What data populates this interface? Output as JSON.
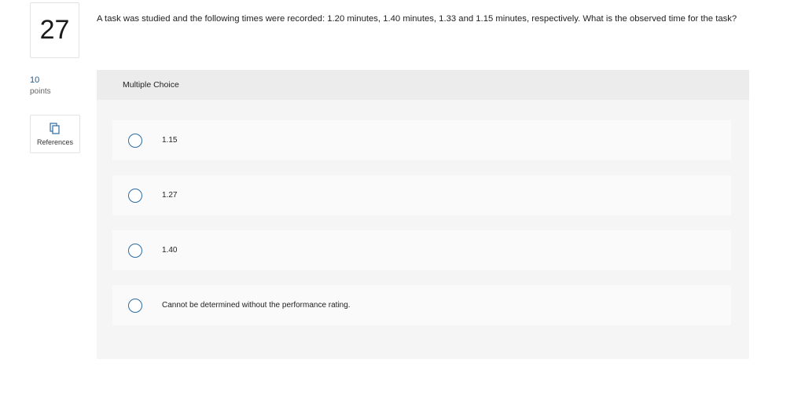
{
  "question": {
    "number": "27",
    "points_value": "10",
    "points_label": "points",
    "references_label": "References",
    "prompt": "A task was studied and the following times were recorded: 1.20 minutes, 1.40 minutes, 1.33 and 1.15 minutes, respectively. What is the observed time for the task?"
  },
  "answer_panel": {
    "type_label": "Multiple Choice",
    "options": [
      {
        "label": "1.15",
        "selected": false
      },
      {
        "label": "1.27",
        "selected": false
      },
      {
        "label": "1.40",
        "selected": false
      },
      {
        "label": "Cannot be determined without the performance rating.",
        "selected": false
      }
    ]
  },
  "colors": {
    "accent": "#2b6ca3",
    "panel_bg": "#f5f5f5",
    "header_bg": "#ececec",
    "option_bg": "#fafafa"
  },
  "icons": {
    "references": "references-icon"
  }
}
